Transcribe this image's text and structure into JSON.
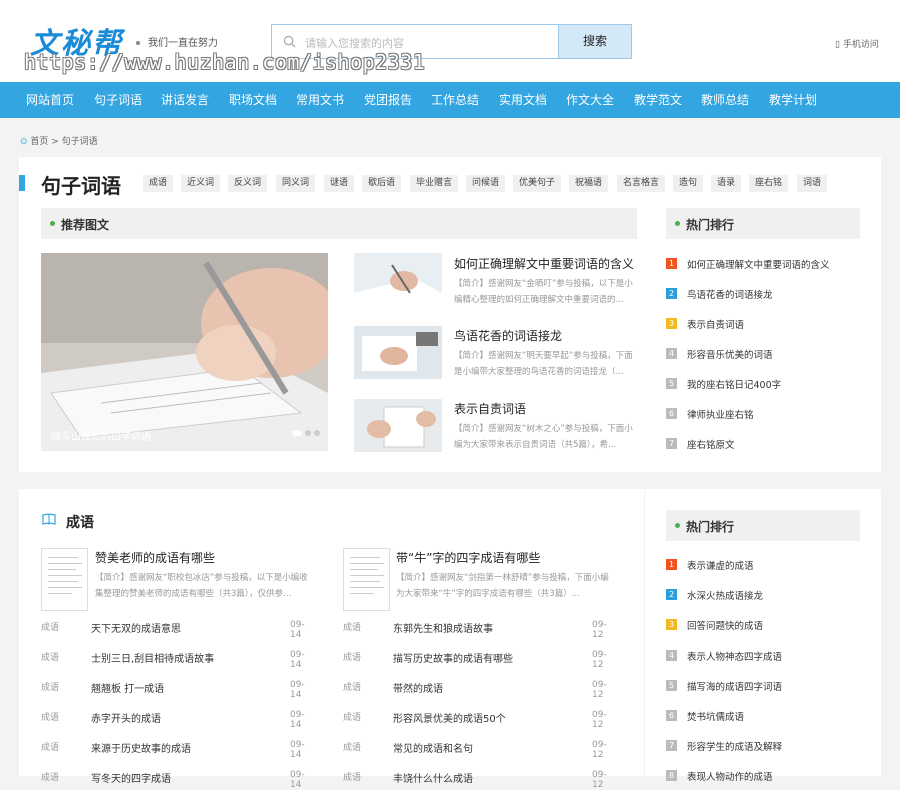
{
  "header": {
    "logo": "文秘帮",
    "slogan": "我们一直在努力",
    "search_placeholder": "请输入您搜索的内容",
    "search_button": "搜索",
    "mobile": "手机访问",
    "watermark": "https://www.huzhan.com/ishop2331"
  },
  "nav": [
    "网站首页",
    "句子词语",
    "讲话发言",
    "职场文档",
    "常用文书",
    "党团报告",
    "工作总结",
    "实用文档",
    "作文大全",
    "教学范文",
    "教师总结",
    "教学计划"
  ],
  "breadcrumb": "首页 > 句子词语",
  "category": {
    "title": "句子词语",
    "tags": [
      "成语",
      "近义词",
      "反义词",
      "同义词",
      "谜语",
      "歇后语",
      "毕业赠言",
      "问候语",
      "优美句子",
      "祝福语",
      "名言格言",
      "造句",
      "语录",
      "座右铭",
      "词语"
    ]
  },
  "recommend": {
    "title": "推荐图文",
    "slider_caption": "描写山峰险的四字词语",
    "items": [
      {
        "title": "如何正确理解文中重要词语的含义",
        "desc": "【简介】感谢网友“金晒叮”参与投稿，以下是小编精心整理的如何正确理解文中重要词语的..."
      },
      {
        "title": "鸟语花香的词语接龙",
        "desc": "【简介】感谢网友“明天要早起”参与投稿，下面是小编带大家整理的鸟语花香的词语接龙（..."
      },
      {
        "title": "表示自责词语",
        "desc": "【简介】感谢网友“树木之心”参与投稿，下面小编为大家带来表示自责词语（共5篇），希..."
      }
    ]
  },
  "hot1": {
    "title": "热门排行",
    "items": [
      "如何正确理解文中重要词语的含义",
      "鸟语花香的词语接龙",
      "表示自责词语",
      "形容音乐优美的词语",
      "我的座右铭日记400字",
      "律师执业座右铭",
      "座右铭原文"
    ]
  },
  "chengyu": {
    "title": "成语",
    "featured": [
      {
        "title": "赞美老师的成语有哪些",
        "desc": "【简介】感谢网友“职校包冰店”参与投稿，以下是小编收集整理的赞美老师的成语有哪些（共3篇），仅供参..."
      },
      {
        "title": "带“牛”字的四字成语有哪些",
        "desc": "【简介】感谢网友“剑指第一林舒晴”参与投稿，下面小编为大家带来“牛”字的四字成语有哪些（共3篇）..."
      }
    ],
    "left_list": [
      {
        "cat": "成语",
        "title": "天下无双的成语意思",
        "date": "09-14"
      },
      {
        "cat": "成语",
        "title": "士别三日,刮目相待成语故事",
        "date": "09-14"
      },
      {
        "cat": "成语",
        "title": "翘翘板 打一成语",
        "date": "09-14"
      },
      {
        "cat": "成语",
        "title": "赤字开头的成语",
        "date": "09-14"
      },
      {
        "cat": "成语",
        "title": "来源于历史故事的成语",
        "date": "09-14"
      },
      {
        "cat": "成语",
        "title": "写冬天的四字成语",
        "date": "09-14"
      }
    ],
    "right_list": [
      {
        "cat": "成语",
        "title": "东郭先生和狼成语故事",
        "date": "09-12"
      },
      {
        "cat": "成语",
        "title": "描写历史故事的成语有哪些",
        "date": "09-12"
      },
      {
        "cat": "成语",
        "title": "带然的成语",
        "date": "09-12"
      },
      {
        "cat": "成语",
        "title": "形容风景优美的成语50个",
        "date": "09-12"
      },
      {
        "cat": "成语",
        "title": "常见的成语和名句",
        "date": "09-12"
      },
      {
        "cat": "成语",
        "title": "丰饶什么什么成语",
        "date": "09-12"
      }
    ]
  },
  "hot2": {
    "title": "热门排行",
    "items": [
      "表示谦虚的成语",
      "水深火热成语接龙",
      "回答问题快的成语",
      "表示人物神态四字成语",
      "描写海的成语四字词语",
      "焚书坑儒成语",
      "形容学生的成语及解释",
      "表现人物动作的成语"
    ]
  },
  "rank_colors": [
    "#f4511e",
    "#29a0db",
    "#f5b820",
    "#bbbbbb"
  ]
}
